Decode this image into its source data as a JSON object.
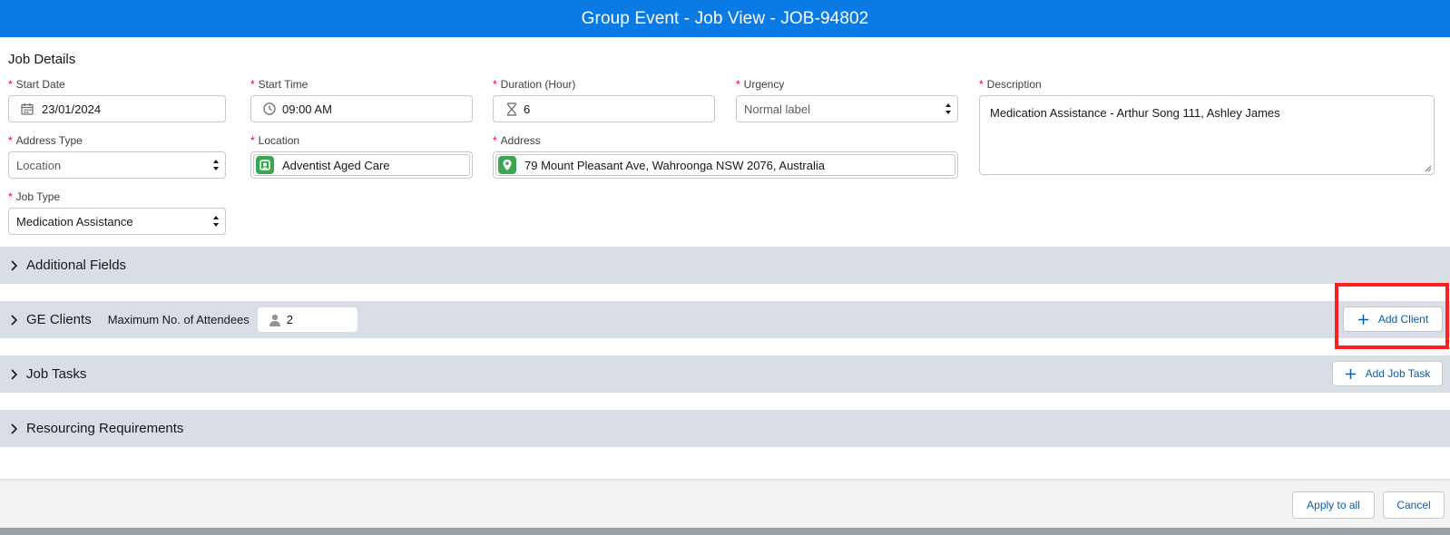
{
  "window": {
    "title": "Group Event - Job View - JOB-94802"
  },
  "job_details": {
    "title": "Job Details",
    "start_date": {
      "label": "Start Date",
      "value": "23/01/2024"
    },
    "start_time": {
      "label": "Start Time",
      "value": "09:00 AM"
    },
    "duration": {
      "label": "Duration (Hour)",
      "value": "6"
    },
    "urgency": {
      "label": "Urgency",
      "value": "Normal label"
    },
    "description": {
      "label": "Description",
      "value": "Medication Assistance - Arthur Song 111, Ashley James"
    },
    "address_type": {
      "label": "Address Type",
      "value": "Location"
    },
    "location": {
      "label": "Location",
      "value": "Adventist Aged Care"
    },
    "address": {
      "label": "Address",
      "value": "79 Mount Pleasant Ave, Wahroonga NSW 2076, Australia"
    },
    "job_type": {
      "label": "Job Type",
      "value": "Medication Assistance"
    },
    "required_marker": "*"
  },
  "sections": {
    "additional_fields": "Additional Fields",
    "ge_clients": "GE Clients",
    "max_attendees_label": "Maximum No. of Attendees",
    "max_attendees_value": "2",
    "job_tasks": "Job Tasks",
    "resourcing": "Resourcing Requirements"
  },
  "buttons": {
    "add_client": "Add Client",
    "add_job_task": "Add Job Task",
    "apply_to_all": "Apply to all",
    "cancel": "Cancel"
  },
  "colors": {
    "title_bar": "#0a7ae5",
    "section_band": "#d8dde6",
    "link_blue": "#0b5cab",
    "required_red": "#ea001e",
    "highlight_red": "#ff1f1f",
    "lookup_badge_green": "#3ba755"
  },
  "icons": {
    "start_date": "calendar-icon",
    "start_time": "clock-icon",
    "duration": "hourglass-icon",
    "location": "location-badge-icon",
    "address": "map-pin-icon",
    "attendees": "person-icon",
    "select": "chevron-updown-icon",
    "section": "chevron-right-icon",
    "add": "plus-icon"
  }
}
